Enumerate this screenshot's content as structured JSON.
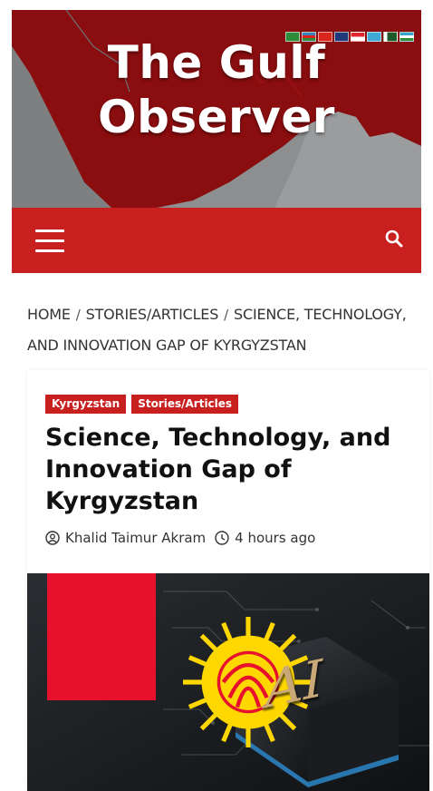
{
  "header": {
    "site_title_line1": "The Gulf",
    "site_title_line2": "Observer",
    "flags": [
      {
        "icon": "saudi-flag-icon",
        "color": "#2e8b3a"
      },
      {
        "icon": "azerbaijan-flag-icon",
        "color": "#3a7fc0"
      },
      {
        "icon": "china-flag-icon",
        "color": "#d9261c"
      },
      {
        "icon": "uk-flag-icon",
        "color": "#1f3a7a"
      },
      {
        "icon": "indonesia-flag-icon",
        "color": "#e0262c"
      },
      {
        "icon": "kazakhstan-flag-icon",
        "color": "#3fa9d6"
      },
      {
        "icon": "pakistan-flag-icon",
        "color": "#1e5b2a"
      },
      {
        "icon": "uzbekistan-flag-icon",
        "color": "#3aa2d0"
      }
    ],
    "colors": {
      "banner_map": "#8a0d0f",
      "land": "#8c8e90",
      "nav": "#c8201f"
    }
  },
  "navbar": {
    "menu_icon": "hamburger-menu-icon",
    "search_icon": "search-icon"
  },
  "breadcrumb": {
    "home": "HOME",
    "category": "STORIES/ARTICLES",
    "current": "SCIENCE, TECHNOLOGY, AND INNOVATION GAP OF KYRGYZSTAN",
    "separator": "/"
  },
  "article": {
    "tags": [
      "Kyrgyzstan",
      "Stories/Articles"
    ],
    "title": "Science, Technology, and Innovation Gap of Kyrgyzstan",
    "author": "Khalid Taimur Akram",
    "time": "4 hours ago",
    "author_icon": "user-icon",
    "time_icon": "clock-icon",
    "image_text": "AI",
    "image_icon": "kyrgyzstan-flag-icon"
  }
}
